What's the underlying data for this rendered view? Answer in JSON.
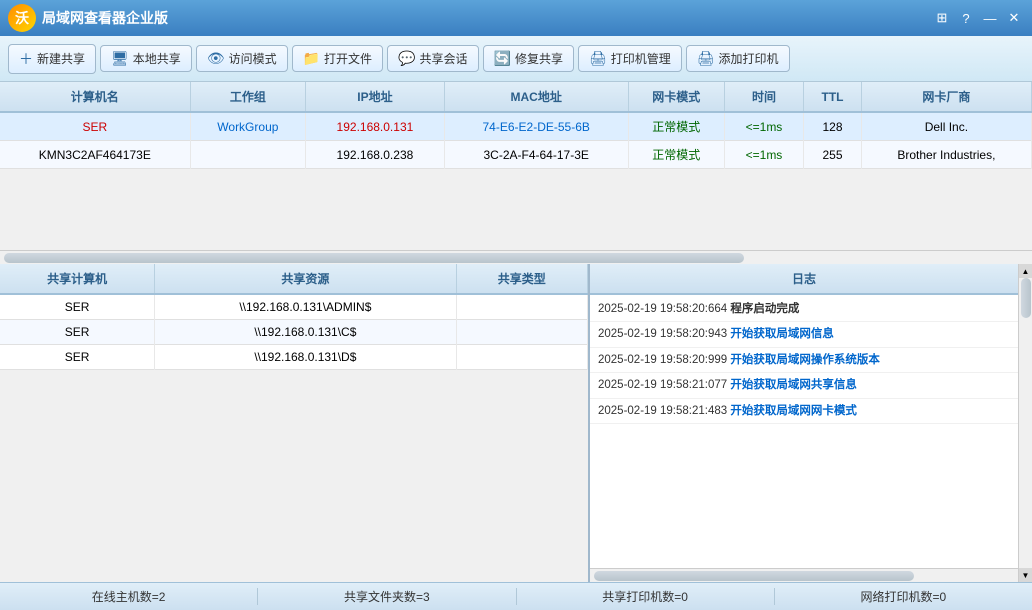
{
  "titleBar": {
    "appName": "局域网查看器企业版",
    "controls": {
      "grid": "⊞",
      "help": "?",
      "minimize": "—",
      "close": "✕"
    }
  },
  "toolbar": {
    "buttons": [
      {
        "id": "new-share",
        "icon": "＋",
        "label": "新建共享"
      },
      {
        "id": "local-share",
        "icon": "🖥",
        "label": "本地共享"
      },
      {
        "id": "access-mode",
        "icon": "👁",
        "label": "访问模式"
      },
      {
        "id": "open-file",
        "icon": "📁",
        "label": "打开文件"
      },
      {
        "id": "share-talk",
        "icon": "💬",
        "label": "共享会话"
      },
      {
        "id": "repair-share",
        "icon": "🔄",
        "label": "修复共享"
      },
      {
        "id": "printer-manage",
        "icon": "🖨",
        "label": "打印机管理"
      },
      {
        "id": "add-printer",
        "icon": "🖨",
        "label": "添加打印机"
      }
    ]
  },
  "networkTable": {
    "headers": [
      "计算机名",
      "工作组",
      "IP地址",
      "MAC地址",
      "网卡模式",
      "时间",
      "TTL",
      "网卡厂商"
    ],
    "rows": [
      {
        "name": "SER",
        "workgroup": "WorkGroup",
        "ip": "192.168.0.131",
        "mac": "74-E6-E2-DE-55-6B",
        "mode": "正常模式",
        "time": "<=1ms",
        "ttl": "128",
        "vendor": "Dell Inc.",
        "selected": true
      },
      {
        "name": "KMN3C2AF464173E",
        "workgroup": "",
        "ip": "192.168.0.238",
        "mac": "3C-2A-F4-64-17-3E",
        "mode": "正常模式",
        "time": "<=1ms",
        "ttl": "255",
        "vendor": "Brother Industries,",
        "selected": false
      }
    ]
  },
  "sharedTable": {
    "headers": [
      "共享计算机",
      "共享资源",
      "共享类型"
    ],
    "rows": [
      {
        "computer": "SER",
        "resource": "\\\\192.168.0.131\\ADMIN$",
        "type": ""
      },
      {
        "computer": "SER",
        "resource": "\\\\192.168.0.131\\C$",
        "type": ""
      },
      {
        "computer": "SER",
        "resource": "\\\\192.168.0.131\\D$",
        "type": ""
      }
    ]
  },
  "logPanel": {
    "header": "日志",
    "entries": [
      {
        "time": "2025-02-19 19:58:20:664",
        "message": "程序启动完成",
        "highlight": false
      },
      {
        "time": "2025-02-19 19:58:20:943",
        "message": "开始获取局域网信息",
        "highlight": true
      },
      {
        "time": "2025-02-19 19:58:20:999",
        "message": "开始获取局域网操作系统版本",
        "highlight": true
      },
      {
        "time": "2025-02-19 19:58:21:077",
        "message": "开始获取局域网共享信息",
        "highlight": true
      },
      {
        "time": "2025-02-19 19:58:21:483",
        "message": "开始获取局域网网卡模式",
        "highlight": true
      }
    ]
  },
  "statusBar": {
    "items": [
      {
        "id": "online-hosts",
        "label": "在线主机数=2"
      },
      {
        "id": "shared-folders",
        "label": "共享文件夹数=3"
      },
      {
        "id": "shared-printers",
        "label": "共享打印机数=0"
      },
      {
        "id": "network-printers",
        "label": "网络打印机数=0"
      }
    ]
  }
}
